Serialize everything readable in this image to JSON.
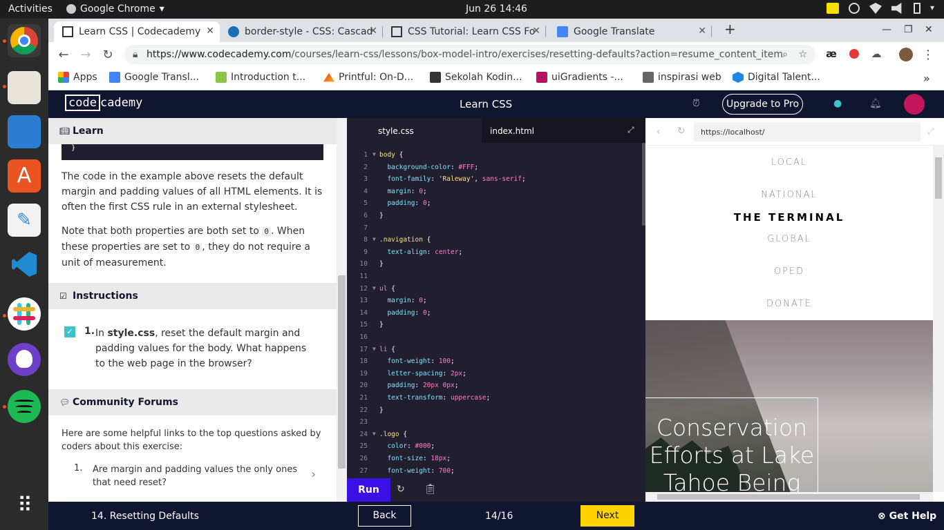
{
  "os": {
    "activities": "Activities",
    "app_name": "Google Chrome",
    "clock": "Jun 26  14:46"
  },
  "browser": {
    "tabs": [
      {
        "title": "Learn CSS | Codecademy"
      },
      {
        "title": "border-style - CSS: Cascad"
      },
      {
        "title": "CSS Tutorial: Learn CSS Fo"
      },
      {
        "title": "Google Translate"
      }
    ],
    "url_host": "https://www.codecademy.com",
    "url_path": "/courses/learn-css/lessons/box-model-intro/exercises/resetting-defaults?action=resume_content_item",
    "bookmarks": [
      {
        "label": "Apps"
      },
      {
        "label": "Google Transl..."
      },
      {
        "label": "Introduction t..."
      },
      {
        "label": "Printful: On-D..."
      },
      {
        "label": "Sekolah Kodin..."
      },
      {
        "label": "uiGradients -..."
      },
      {
        "label": "inspirasi web"
      },
      {
        "label": "Digital Talent..."
      }
    ],
    "more_bookmarks": "»"
  },
  "cc": {
    "logo_a": "code",
    "logo_b": "cademy",
    "course_title": "Learn CSS",
    "upgrade": "Upgrade to Pro"
  },
  "learn": {
    "learn_heading": "Learn",
    "code_tail": "}",
    "p1": "The code in the example above resets the default margin and padding values of all HTML elements. It is often the first CSS rule in an external stylesheet.",
    "p2_a": "Note that both properties are both set to ",
    "p2_code": "0",
    "p2_b": ". When these properties are set to ",
    "p2_code2": "0",
    "p2_c": ", they do not require a unit of measurement.",
    "instructions_heading": "Instructions",
    "instr_num": "1.",
    "instr_a": "In ",
    "instr_file": "style.css",
    "instr_b": ", reset the default margin and padding values for the body. What happens to the web page in the browser?",
    "forums_heading": "Community Forums",
    "forums_intro": "Here are some helpful links to the top questions asked by coders about this exercise:",
    "forum_q_num": "1.",
    "forum_q": "Are margin and padding values the only ones that need reset?"
  },
  "editor": {
    "tab_css": "style.css",
    "tab_html": "index.html",
    "run": "Run"
  },
  "preview": {
    "url": "https://localhost/",
    "nav": [
      "LOCAL",
      "NATIONAL",
      "THE TERMINAL",
      "GLOBAL",
      "OPED",
      "DONATE"
    ],
    "hero_title": "Conservation Efforts at Lake Tahoe Being"
  },
  "footer": {
    "lesson": "14. Resetting Defaults",
    "back": "Back",
    "progress": "14/16",
    "next": "Next",
    "help": "Get Help"
  },
  "code_lines": [
    {
      "n": "1",
      "fold": true,
      "html": "<span class='sel'>body</span> {"
    },
    {
      "n": "2",
      "html": "  <span class='prop'>background-color</span>: <span class='val'>#FFF</span>;"
    },
    {
      "n": "3",
      "html": "  <span class='prop'>font-family</span>: <span class='str'>'Raleway'</span>, <span class='val'>sans-serif</span>;"
    },
    {
      "n": "4",
      "html": "  <span class='prop'>margin</span>: <span class='num'>0</span>;"
    },
    {
      "n": "5",
      "html": "  <span class='prop'>padding</span>: <span class='num'>0</span>;"
    },
    {
      "n": "6",
      "html": "}"
    },
    {
      "n": "7",
      "html": ""
    },
    {
      "n": "8",
      "fold": true,
      "html": "<span class='sel'>.navigation</span> {"
    },
    {
      "n": "9",
      "html": "  <span class='prop'>text-align</span>: <span class='val'>center</span>;"
    },
    {
      "n": "10",
      "html": "}"
    },
    {
      "n": "11",
      "html": ""
    },
    {
      "n": "12",
      "fold": true,
      "html": "<span class='tag'>ul</span> {"
    },
    {
      "n": "13",
      "html": "  <span class='prop'>margin</span>: <span class='num'>0</span>;"
    },
    {
      "n": "14",
      "html": "  <span class='prop'>padding</span>: <span class='num'>0</span>;"
    },
    {
      "n": "15",
      "html": "}"
    },
    {
      "n": "16",
      "html": ""
    },
    {
      "n": "17",
      "fold": true,
      "html": "<span class='tag'>li</span> {"
    },
    {
      "n": "18",
      "html": "  <span class='prop'>font-weight</span>: <span class='num'>100</span>;"
    },
    {
      "n": "19",
      "html": "  <span class='prop'>letter-spacing</span>: <span class='num'>2px</span>;"
    },
    {
      "n": "20",
      "html": "  <span class='prop'>padding</span>: <span class='num'>20px 0px</span>;"
    },
    {
      "n": "21",
      "html": "  <span class='prop'>text-transform</span>: <span class='val'>uppercase</span>;"
    },
    {
      "n": "22",
      "html": "}"
    },
    {
      "n": "23",
      "html": ""
    },
    {
      "n": "24",
      "fold": true,
      "html": "<span class='sel'>.logo</span> {"
    },
    {
      "n": "25",
      "html": "  <span class='prop'>color</span>: <span class='val'>#000</span>;"
    },
    {
      "n": "26",
      "html": "  <span class='prop'>font-size</span>: <span class='num'>18px</span>;"
    },
    {
      "n": "27",
      "html": "  <span class='prop'>font-weight</span>: <span class='num'>700</span>;"
    }
  ]
}
